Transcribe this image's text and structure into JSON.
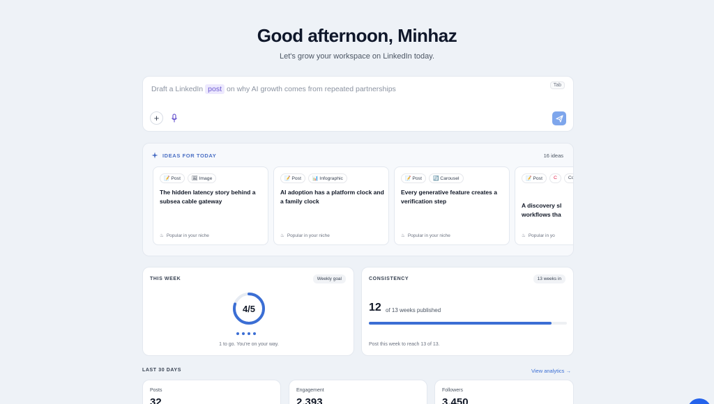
{
  "header": {
    "greeting": "Good afternoon, Minhaz",
    "subtitle": "Let's grow your workspace on LinkedIn today."
  },
  "composer": {
    "prefix": "Draft a LinkedIn",
    "chip": "post",
    "suffix": "on why AI growth comes from repeated partnerships",
    "tab_hint": "Tab"
  },
  "ideas": {
    "title": "IDEAS FOR TODAY",
    "count": "16 ideas",
    "cards": [
      {
        "tags": [
          "📝 Post",
          "🖼 Image"
        ],
        "title": "The hidden latency story behind a subsea cable gateway",
        "footer": "Popular in your niche"
      },
      {
        "tags": [
          "📝 Post",
          "📊 Infographic"
        ],
        "title": "AI adoption has a platform clock and a family clock",
        "footer": "Popular in your niche"
      },
      {
        "tags": [
          "📝 Post",
          "🔄 Carousel"
        ],
        "title": "Every generative feature creates a verification step",
        "footer": "Popular in your niche"
      },
      {
        "tags": [
          "📝 Post",
          "C",
          "Cover image"
        ],
        "title": "A discovery sl workflows tha",
        "footer": "Popular in yo"
      }
    ]
  },
  "this_week": {
    "label": "THIS WEEK",
    "pill": "Weekly goal",
    "progress_text": "4/5",
    "progress_fraction": 0.8,
    "note": "1 to go. You're on your way."
  },
  "consistency": {
    "label": "CONSISTENCY",
    "pill": "13 weeks in",
    "number": "12",
    "of_text": "of 13 weeks published",
    "progress_fraction": 0.923,
    "note": "Post this week to reach 13 of 13."
  },
  "last30": {
    "label": "LAST 30 DAYS",
    "link": "View analytics →",
    "stats": [
      {
        "label": "Posts",
        "value": "32"
      },
      {
        "label": "Engagement",
        "value": "2,393"
      },
      {
        "label": "Followers",
        "value": "3,450"
      }
    ]
  },
  "colors": {
    "accent": "#3b6ed4",
    "send": "#7ea6ec",
    "chip_bg": "#ede9fe",
    "background": "#eef2f7"
  }
}
